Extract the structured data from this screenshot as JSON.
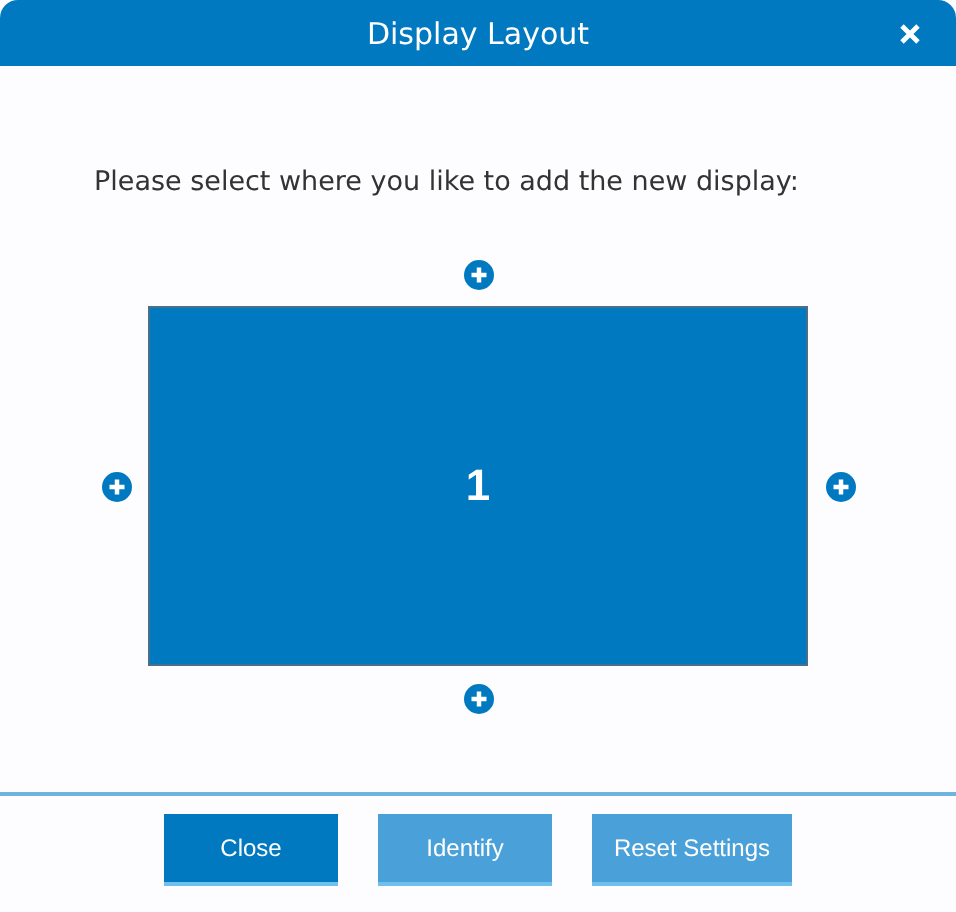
{
  "window": {
    "title": "Display Layout"
  },
  "instruction": "Please select where you like to add the new display:",
  "display": {
    "label": "1"
  },
  "buttons": [
    {
      "label": "Close",
      "kind": "primary"
    },
    {
      "label": "Identify",
      "kind": "secondary"
    },
    {
      "label": "Reset Settings",
      "kind": "secondary"
    }
  ]
}
